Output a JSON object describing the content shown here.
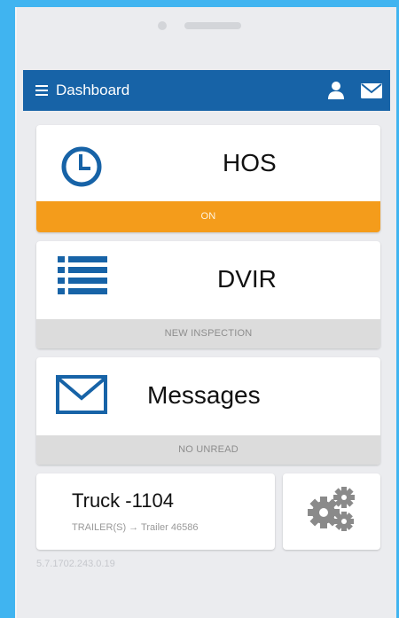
{
  "header": {
    "title": "Dashboard",
    "menu_icon": "hamburger-menu-icon",
    "user_icon": "user-icon",
    "mail_icon": "envelope-icon",
    "color": "#1763a7"
  },
  "cards": {
    "hos": {
      "title": "HOS",
      "status": "ON",
      "icon": "clock-icon",
      "status_color": "#f49c1b"
    },
    "dvir": {
      "title": "DVIR",
      "status": "NEW INSPECTION",
      "icon": "list-icon"
    },
    "messages": {
      "title": "Messages",
      "status": "NO UNREAD",
      "icon": "envelope-icon"
    }
  },
  "vehicle": {
    "truck": "Truck -1104",
    "trailer": "TRAILER(S) → Trailer 46586"
  },
  "settings": {
    "icon": "gears-icon"
  },
  "version": "5.7.1702.243.0.19"
}
